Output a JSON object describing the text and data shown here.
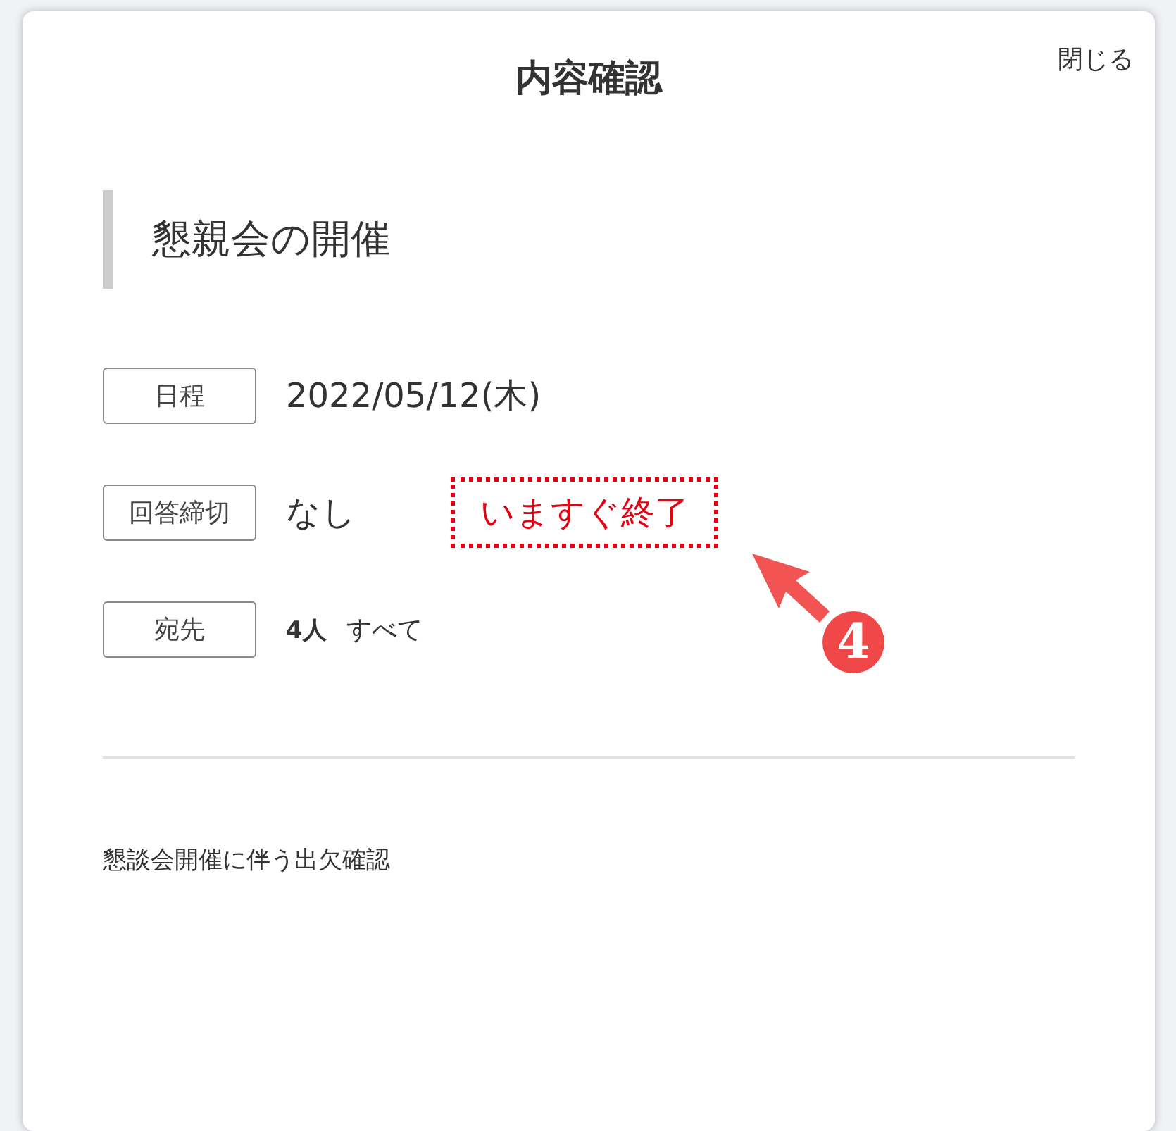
{
  "dialog": {
    "title": "内容確認",
    "close": "閉じる"
  },
  "heading": "懇親会の開催",
  "rows": [
    {
      "kind": "text",
      "label": "日程",
      "value": "2022/05/12(木)"
    },
    {
      "kind": "deadline",
      "label": "回答締切",
      "value": "なし",
      "action": "いますぐ終了",
      "highlighted": true
    },
    {
      "kind": "recipients",
      "label": "宛先",
      "count": "4人",
      "value": "すべて"
    }
  ],
  "annotation": {
    "marker": "4"
  },
  "description": "懇談会開催に伴う出欠確認"
}
